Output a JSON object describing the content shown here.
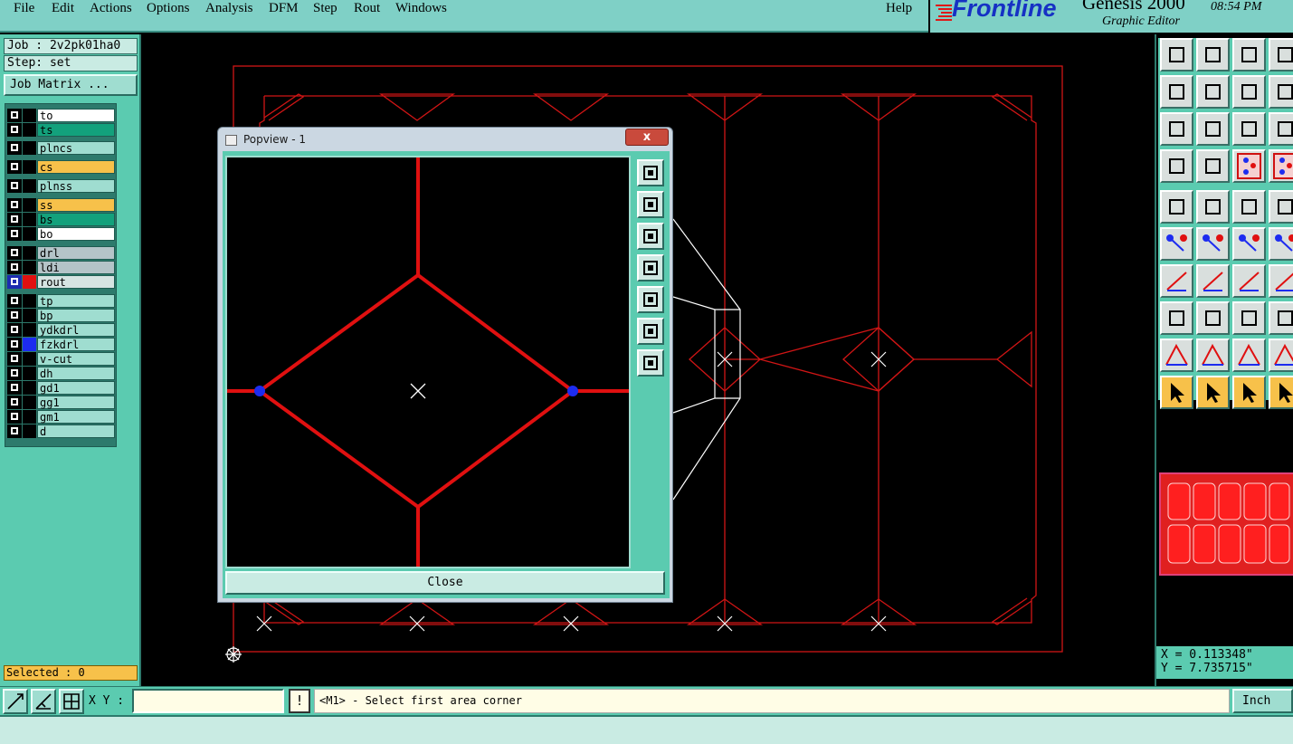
{
  "menu": {
    "file": "File",
    "edit": "Edit",
    "actions": "Actions",
    "options": "Options",
    "analysis": "Analysis",
    "dfm": "DFM",
    "step": "Step",
    "rout": "Rout",
    "windows": "Windows",
    "help": "Help"
  },
  "brand": {
    "logo": "Frontline",
    "title": "Genesis 2000",
    "subtitle": "Graphic Editor",
    "clock": "08:54 PM"
  },
  "job": {
    "job_label": "Job : 2v2pk01ha0",
    "step_label": "Step: set",
    "matrix_button": "Job Matrix ..."
  },
  "layers": [
    {
      "name": "to",
      "color": "#ffffff"
    },
    {
      "name": "ts",
      "color": "#13a17c"
    },
    {
      "name": "plncs",
      "color": "#9fddd0"
    },
    {
      "name": "cs",
      "color": "#f7c14a"
    },
    {
      "name": "plnss",
      "color": "#9fddd0"
    },
    {
      "name": "ss",
      "color": "#f7c14a"
    },
    {
      "name": "bs",
      "color": "#13a17c"
    },
    {
      "name": "bo",
      "color": "#ffffff"
    },
    {
      "name": "drl",
      "color": "#b4c4c8"
    },
    {
      "name": "ldi",
      "color": "#b4c4c8"
    },
    {
      "name": "rout",
      "color": "#d6e4e2"
    },
    {
      "name": "tp",
      "color": "#9fddd0"
    },
    {
      "name": "bp",
      "color": "#9fddd0"
    },
    {
      "name": "ydkdrl",
      "color": "#9fddd0"
    },
    {
      "name": "fzkdrl",
      "color": "#9fddd0"
    },
    {
      "name": "v-cut",
      "color": "#9fddd0"
    },
    {
      "name": "dh",
      "color": "#9fddd0"
    },
    {
      "name": "gd1",
      "color": "#9fddd0"
    },
    {
      "name": "gg1",
      "color": "#9fddd0"
    },
    {
      "name": "gm1",
      "color": "#9fddd0"
    },
    {
      "name": "d",
      "color": "#9fddd0"
    }
  ],
  "selected": "Selected : 0",
  "popview": {
    "title": "Popview - 1",
    "close_x": "x",
    "close_button": "Close"
  },
  "coords": {
    "x": "X = 0.113348\"",
    "y": "Y = 7.735715\""
  },
  "status": {
    "xy_label": "X Y :",
    "xy_value": "",
    "bang": "!",
    "prompt": "<M1> - Select first area corner",
    "units": "Inch"
  },
  "colors": {
    "panel": "#5bcbb0",
    "menubar": "#7fd0c6",
    "route": "#e01010",
    "accent_orange": "#f7c14a"
  }
}
